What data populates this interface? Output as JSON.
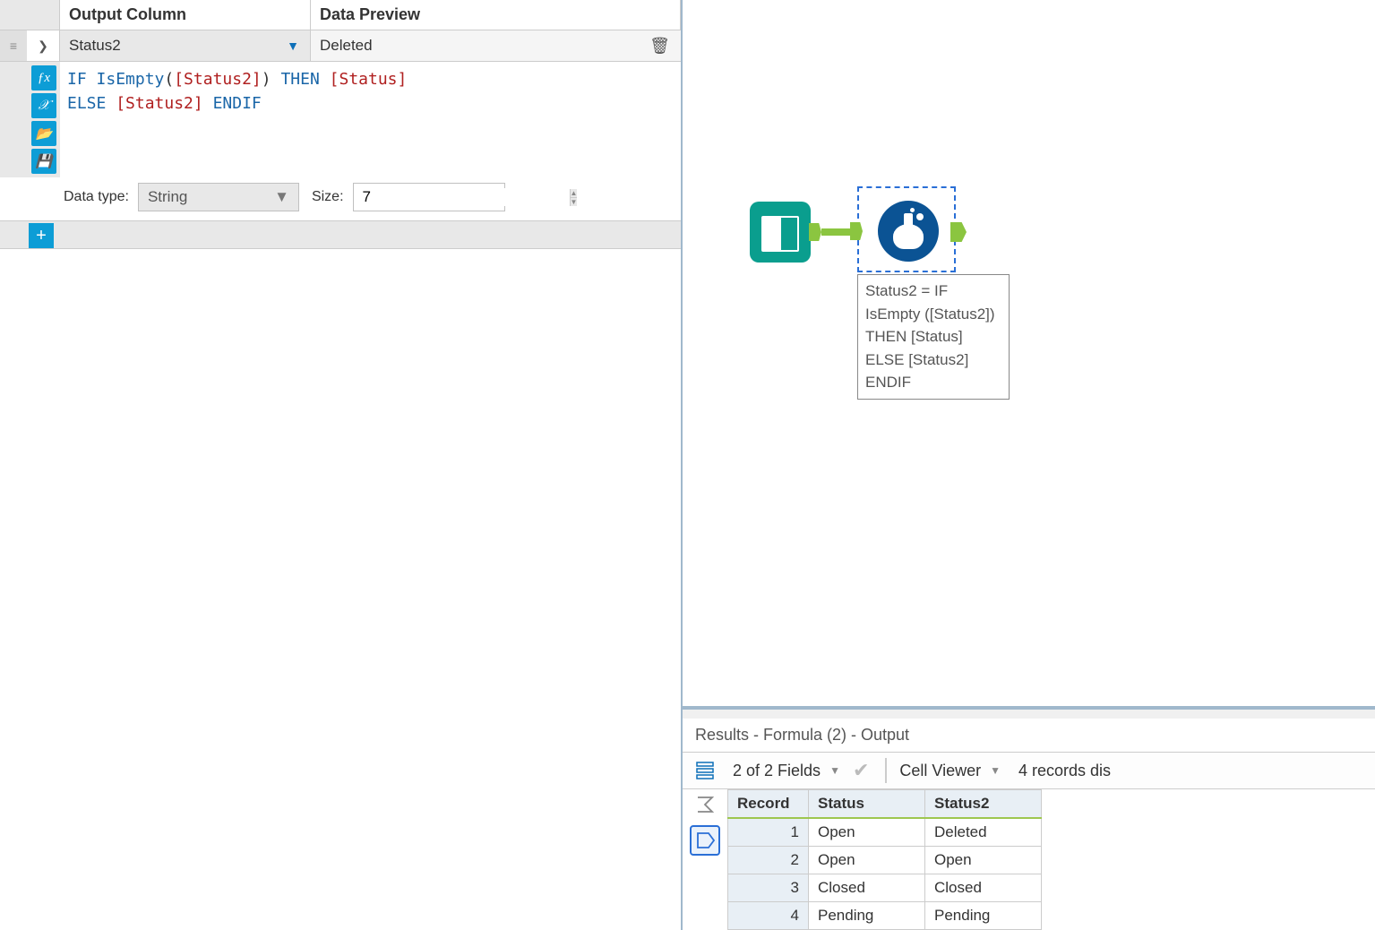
{
  "config": {
    "headers": {
      "output_column": "Output Column",
      "data_preview": "Data Preview"
    },
    "output_column_value": "Status2",
    "data_preview_value": "Deleted",
    "formula_tokens": [
      "IF ",
      "IsEmpty",
      "(",
      "[Status2]",
      ")",
      " THEN ",
      "[Status]",
      "\n",
      "ELSE ",
      "[Status2]",
      " ENDIF"
    ],
    "data_type_label": "Data type:",
    "data_type_value": "String",
    "size_label": "Size:",
    "size_value": "7"
  },
  "canvas": {
    "annotation": "Status2 = IF IsEmpty ([Status2]) THEN [Status]\nELSE [Status2] ENDIF"
  },
  "results": {
    "title": "Results - Formula (2) - Output",
    "fields_text": "2 of 2 Fields",
    "cell_viewer_text": "Cell Viewer",
    "records_text": "4 records dis",
    "columns": [
      "Record",
      "Status",
      "Status2"
    ],
    "rows": [
      {
        "record": 1,
        "Status": "Open",
        "Status2": "Deleted"
      },
      {
        "record": 2,
        "Status": "Open",
        "Status2": "Open"
      },
      {
        "record": 3,
        "Status": "Closed",
        "Status2": "Closed"
      },
      {
        "record": 4,
        "Status": "Pending",
        "Status2": "Pending"
      }
    ]
  }
}
